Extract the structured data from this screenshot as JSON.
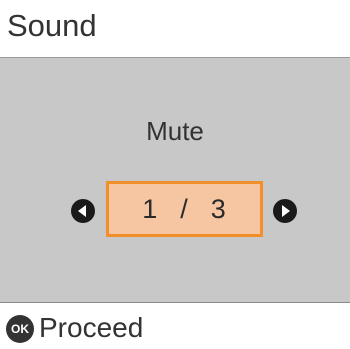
{
  "header": {
    "title": "Sound"
  },
  "setting": {
    "label": "Mute",
    "current_page": "1",
    "separator": "/",
    "total_pages": "3"
  },
  "footer": {
    "ok_icon_text": "OK",
    "action_label": "Proceed"
  },
  "colors": {
    "panel_bg": "#c8c8c8",
    "highlight_fill": "#f6c6a2",
    "highlight_border": "#f18f2a"
  },
  "icons": {
    "prev": "chevron-left-icon",
    "next": "chevron-right-icon",
    "ok": "ok-icon"
  }
}
